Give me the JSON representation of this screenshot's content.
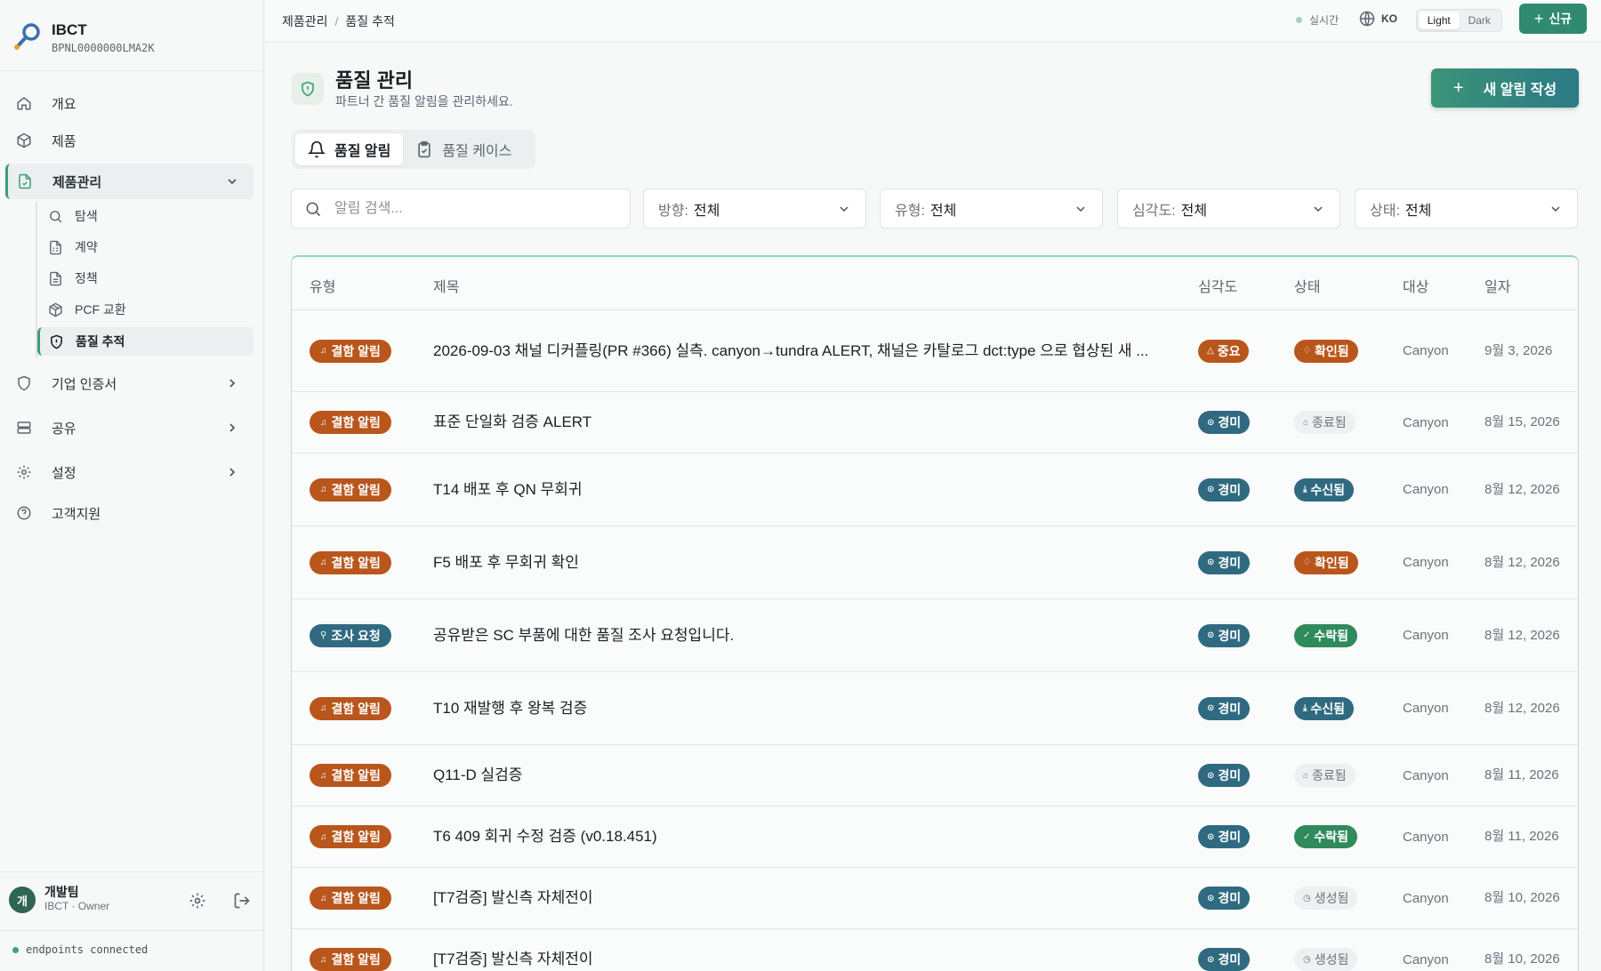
{
  "brand": {
    "name": "IBCT",
    "id": "BPNL0000000LMA2K"
  },
  "nav": {
    "overview": "개요",
    "products": "제품",
    "product_mgmt": "제품관리",
    "sub": {
      "search": "탐색",
      "contract": "계약",
      "policy": "정책",
      "pcf": "PCF 교환",
      "quality": "품질 추적"
    },
    "certs": "기업 인증서",
    "share": "공유",
    "settings": "설정",
    "support": "고객지원"
  },
  "user": {
    "avatar": "개",
    "name": "개발팀",
    "role": "IBCT · Owner"
  },
  "connection": "endpoints connected",
  "topbar": {
    "crumb_parent": "제품관리",
    "crumb_sep": "/",
    "crumb_current": "품질 추적",
    "live": "실시간",
    "lang": "KO",
    "theme_light": "Light",
    "theme_dark": "Dark",
    "new_label": "신규"
  },
  "page": {
    "title": "품질 관리",
    "subtitle": "파트너 간 품질 알림을 관리하세요.",
    "create_label": "새 알림 작성"
  },
  "tabs": {
    "alerts": "품질 알림",
    "cases": "품질 케이스"
  },
  "filters": {
    "search_placeholder": "알림 검색...",
    "direction_label": "방향:",
    "direction_value": "전체",
    "type_label": "유형:",
    "type_value": "전체",
    "severity_label": "심각도:",
    "severity_value": "전체",
    "status_label": "상태:",
    "status_value": "전체"
  },
  "table": {
    "headers": {
      "type": "유형",
      "title": "제목",
      "severity": "심각도",
      "status": "상태",
      "target": "대상",
      "date": "일자"
    },
    "rows": [
      {
        "type": "결함 알림",
        "title": "2026-09-03 채널 디커플링(PR #366) 실측. canyon→tundra ALERT, 채널은 카탈로그 dct:type 으로 협상된 새 ...",
        "severity": "중요",
        "status": "확인됨",
        "target": "Canyon",
        "date": "9월 3, 2026"
      },
      {
        "type": "결함 알림",
        "title": "표준 단일화 검증 ALERT",
        "severity": "경미",
        "status": "종료됨",
        "target": "Canyon",
        "date": "8월 15, 2026"
      },
      {
        "type": "결함 알림",
        "title": "T14 배포 후 QN 무회귀",
        "severity": "경미",
        "status": "수신됨",
        "target": "Canyon",
        "date": "8월 12, 2026"
      },
      {
        "type": "결함 알림",
        "title": "F5 배포 후 무회귀 확인",
        "severity": "경미",
        "status": "확인됨",
        "target": "Canyon",
        "date": "8월 12, 2026"
      },
      {
        "type": "조사 요청",
        "title": "공유받은 SC 부품에 대한 품질 조사 요청입니다.",
        "severity": "경미",
        "status": "수락됨",
        "target": "Canyon",
        "date": "8월 12, 2026"
      },
      {
        "type": "결함 알림",
        "title": "T10 재발행 후 왕복 검증",
        "severity": "경미",
        "status": "수신됨",
        "target": "Canyon",
        "date": "8월 12, 2026"
      },
      {
        "type": "결함 알림",
        "title": "Q11-D 실검증",
        "severity": "경미",
        "status": "종료됨",
        "target": "Canyon",
        "date": "8월 11, 2026"
      },
      {
        "type": "결함 알림",
        "title": "T6 409 회귀 수정 검증 (v0.18.451)",
        "severity": "경미",
        "status": "수락됨",
        "target": "Canyon",
        "date": "8월 11, 2026"
      },
      {
        "type": "결함 알림",
        "title": "[T7검증] 발신측 자체전이",
        "severity": "경미",
        "status": "생성됨",
        "target": "Canyon",
        "date": "8월 10, 2026"
      },
      {
        "type": "결함 알림",
        "title": "[T7검증] 발신측 자체전이",
        "severity": "경미",
        "status": "생성됨",
        "target": "Canyon",
        "date": "8월 10, 2026"
      }
    ]
  },
  "colors": {
    "accent": "#2f8a6e",
    "alert_orange": "#b9561c",
    "minor_blue": "#2f6a80",
    "accepted_green": "#2f8a5c"
  }
}
